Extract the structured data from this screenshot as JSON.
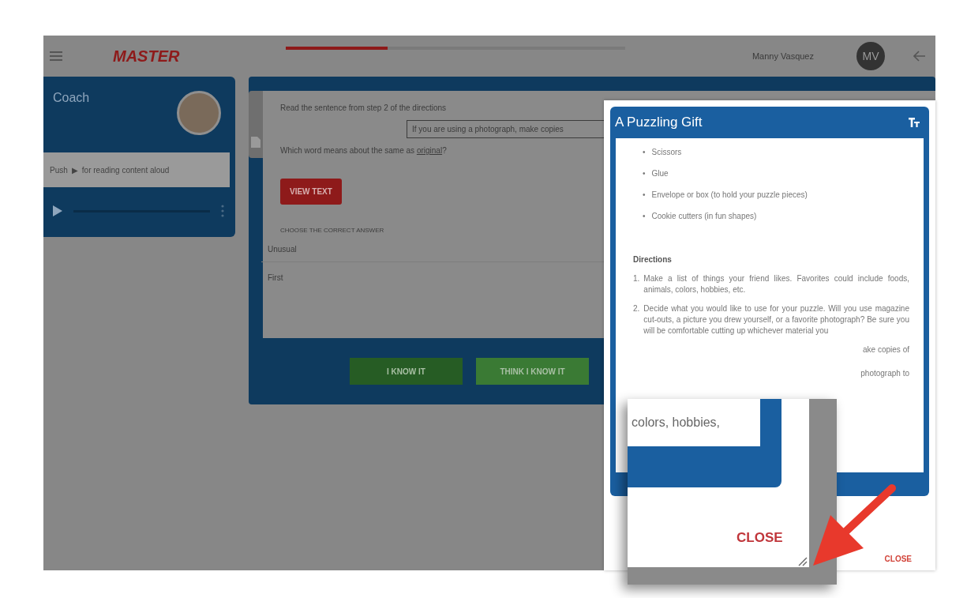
{
  "header": {
    "logo": "MASTER",
    "progress": {
      "level": 0.3
    },
    "user_name": "Manny Vasquez",
    "avatar_initials": "MV"
  },
  "coach": {
    "title": "Coach",
    "hint_before": "Push",
    "hint_icon": "▶",
    "hint_after": "for reading content aloud"
  },
  "question": {
    "instruction": "Read the sentence from step 2 of the directions",
    "quote": "If you are using a photograph, make copies",
    "prompt": "Which word means about the same as ",
    "prompt_term": "original",
    "prompt_end": "?",
    "view_text_button": "VIEW TEXT",
    "choose_label": "CHOOSE THE CORRECT ANSWER",
    "answers": [
      {
        "text": "Unusual"
      },
      {
        "text": "First"
      }
    ]
  },
  "confidence_buttons": [
    {
      "label": "I KNOW IT",
      "kind": "sure"
    },
    {
      "label": "THINK I KNOW IT",
      "kind": "unsure"
    }
  ],
  "dialog": {
    "title": "A Puzzling Gift",
    "materials": [
      {
        "marker": "•",
        "text": "Scissors"
      },
      {
        "marker": "•",
        "text": "Glue"
      },
      {
        "marker": "•",
        "text": "Envelope or box (to hold your puzzle pieces)"
      },
      {
        "marker": "•",
        "text": "Cookie cutters (in fun shapes)"
      }
    ],
    "directions_heading": "Directions",
    "steps": [
      {
        "number": "1.",
        "text": "Make a list of things your friend likes. Favorites could include foods, animals, colors, hobbies, etc."
      },
      {
        "number": "2.",
        "text": "Decide what you would like to use for your puzzle. Will you use magazine cut-outs, a picture you drew yourself, or a favorite photograph? Be sure you will be comfortable cutting up whichever material you"
      }
    ],
    "fragments": [
      "ake copies of",
      "photograph to"
    ],
    "close": "CLOSE"
  },
  "magnifier": {
    "text": "colors, hobbies,",
    "close": "CLOSE"
  }
}
